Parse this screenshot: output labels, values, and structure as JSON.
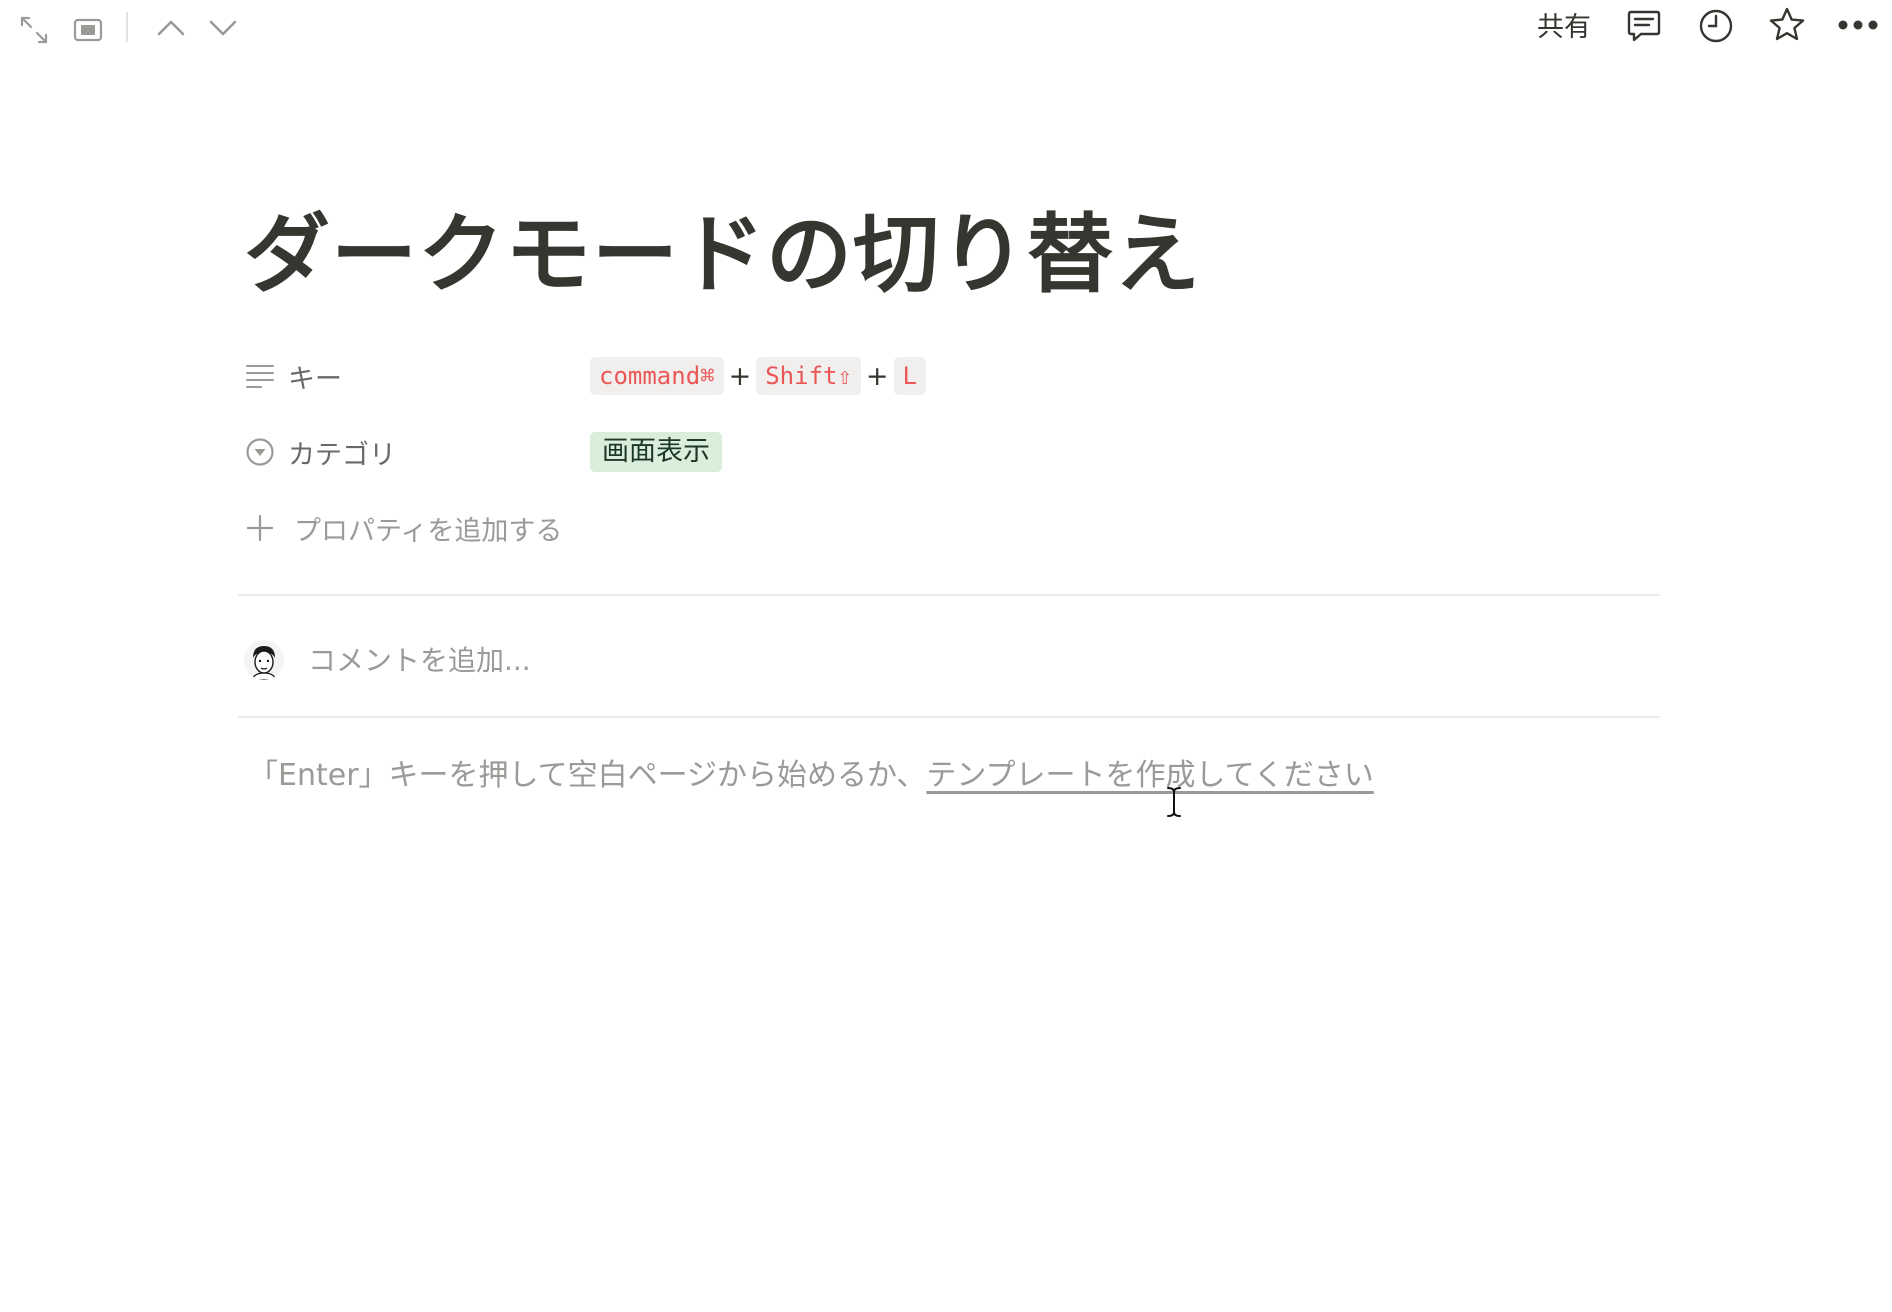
{
  "topbar": {
    "icons": {
      "expand": "expand-arrows-icon",
      "peek_mode": "peek-mode-icon",
      "prev": "chevron-up-icon",
      "next": "chevron-down-icon",
      "comments": "comment-icon",
      "updates": "clock-icon",
      "favorite": "star-icon",
      "more": "more-dots-icon"
    },
    "share_label": "共有"
  },
  "page": {
    "title": "ダークモードの切り替え",
    "properties": [
      {
        "name": "キー",
        "icon": "text-lines-icon",
        "keys": [
          "command⌘",
          "Shift⇧",
          "L"
        ],
        "separator": "+"
      },
      {
        "name": "カテゴリ",
        "icon": "select-icon",
        "tag": "画面表示",
        "tag_color": "#dbeddb"
      }
    ],
    "add_property_label": "プロパティを追加する",
    "comment": {
      "placeholder": "コメントを追加..."
    },
    "empty_hint": {
      "text": "「Enter」キーを押して空白ページから始めるか、",
      "link": "テンプレートを作成してください"
    }
  },
  "colors": {
    "code_text": "#eb5757",
    "code_bg": "#f0efed",
    "placeholder": "#9b9a97",
    "tag_bg": "#dbeddb"
  }
}
